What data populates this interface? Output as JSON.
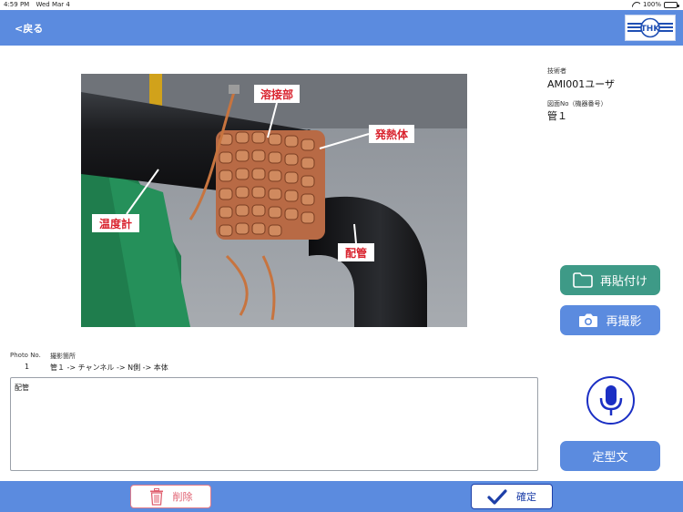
{
  "status_bar": {
    "time": "4:59 PM",
    "date": "Wed Mar 4",
    "battery": "100%"
  },
  "header": {
    "back_label": "<戻る",
    "logo_text": "THK"
  },
  "photo": {
    "labels": {
      "welded": "溶接部",
      "heater": "発熱体",
      "thermometer": "温度計",
      "pipe": "配管"
    }
  },
  "info": {
    "engineer_label": "技術者",
    "engineer_value": "AMI001ユーザ",
    "drawing_label": "図面No（機器番号）",
    "drawing_value": "管１"
  },
  "meta": {
    "photo_no_label": "Photo No.",
    "photo_no_value": "1",
    "location_label": "撮影箇所",
    "location_value": "管１ -> チャンネル -> N側 -> 本体"
  },
  "note": {
    "value": "配管"
  },
  "buttons": {
    "paste": "再貼付け",
    "reshoot": "再撮影",
    "phrase": "定型文",
    "delete": "削除",
    "confirm": "確定"
  },
  "colors": {
    "header": "#5b8bdf",
    "paste_button": "#3e9a87",
    "mic": "#1b2fc4",
    "delete": "#e06070",
    "confirm": "#1d3fa8"
  }
}
